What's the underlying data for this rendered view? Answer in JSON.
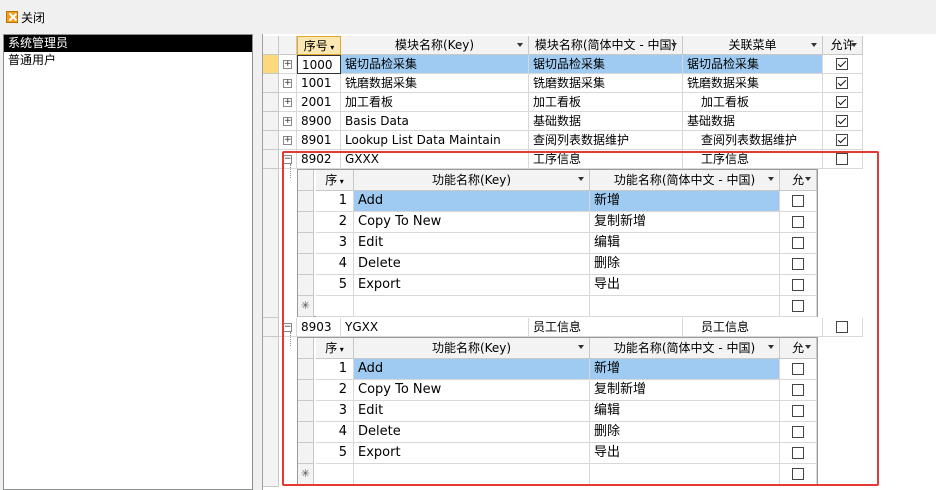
{
  "toolbar": {
    "close_label": "关闭"
  },
  "users": [
    "系统管理员",
    "普通用户"
  ],
  "main_columns": [
    "序号",
    "模块名称(Key)",
    "模块名称(简体中文 - 中国)",
    "关联菜单",
    "允许"
  ],
  "modules": [
    {
      "no": "1000",
      "key": "锯切品检采集",
      "name": "锯切品检采集",
      "menu": "锯切品检采集",
      "allow": true
    },
    {
      "no": "1001",
      "key": "铣磨数据采集",
      "name": "铣磨数据采集",
      "menu": "铣磨数据采集",
      "allow": true
    },
    {
      "no": "2001",
      "key": "加工看板",
      "name": "加工看板",
      "menu": "加工看板",
      "allow": true
    },
    {
      "no": "8900",
      "key": "Basis Data",
      "name": "基础数据",
      "menu": "基础数据",
      "allow": true
    },
    {
      "no": "8901",
      "key": "Lookup List Data Maintain",
      "name": "查阅列表数据维护",
      "menu": "查阅列表数据维护",
      "allow": true
    },
    {
      "no": "8902",
      "key": "GXXX",
      "name": "工序信息",
      "menu": "工序信息",
      "allow": false
    },
    {
      "no": "8903",
      "key": "YGXX",
      "name": "员工信息",
      "menu": "员工信息",
      "allow": false
    }
  ],
  "sub_columns": [
    "序",
    "功能名称(Key)",
    "功能名称(简体中文 - 中国)",
    "允"
  ],
  "functions": [
    {
      "no": "1",
      "key": "Add",
      "name": "新增"
    },
    {
      "no": "2",
      "key": "Copy To New",
      "name": "复制新增"
    },
    {
      "no": "3",
      "key": "Edit",
      "name": "编辑"
    },
    {
      "no": "4",
      "key": "Delete",
      "name": "删除"
    },
    {
      "no": "5",
      "key": "Export",
      "name": "导出"
    }
  ],
  "new_row_marker": "✳"
}
